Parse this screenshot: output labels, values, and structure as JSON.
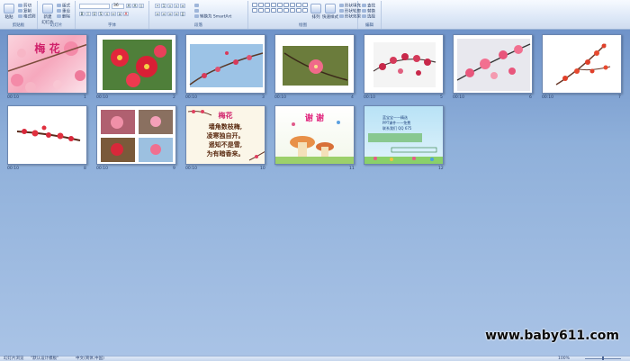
{
  "ribbon": {
    "groups": [
      {
        "label": "剪贴板"
      },
      {
        "label": "幻灯片"
      },
      {
        "label": "字体"
      },
      {
        "label": "段落"
      },
      {
        "label": "绘图"
      },
      {
        "label": "编辑"
      }
    ],
    "clipboard": {
      "paste": "粘贴",
      "cut": "剪切",
      "copy": "复制",
      "painter": "格式刷"
    },
    "slides": {
      "new_slide": "新建\n幻灯片",
      "layout": "版式",
      "reset": "重设",
      "delete": "删除"
    },
    "font": {
      "font_value": "",
      "size_value": "36"
    },
    "paragraph": {
      "smartart": "转换为 SmartArt"
    },
    "drawing": {
      "arrange": "排列",
      "quick_styles": "快速样式",
      "fill": "形状填充",
      "outline": "形状轮廓",
      "effects": "形状效果"
    },
    "editing": {
      "find": "查找",
      "replace": "替换",
      "select": "选择"
    }
  },
  "slides": [
    {
      "number": "1",
      "meta": "00:10",
      "title": "梅 花"
    },
    {
      "number": "2",
      "meta": "00:10"
    },
    {
      "number": "3",
      "meta": "00:10"
    },
    {
      "number": "4",
      "meta": "00:10"
    },
    {
      "number": "5",
      "meta": "00:10"
    },
    {
      "number": "6",
      "meta": "00:10"
    },
    {
      "number": "7",
      "meta": "00:10"
    },
    {
      "number": "8",
      "meta": "00:10"
    },
    {
      "number": "9",
      "meta": "00:10"
    },
    {
      "number": "10",
      "meta": "00:10",
      "title": "梅花",
      "poem": [
        "墙角数枝梅,",
        "凌寒独自开。",
        "遥知不是雪,",
        "为有暗香来。"
      ]
    },
    {
      "number": "11",
      "meta": "",
      "title": "谢 谢"
    },
    {
      "number": "12",
      "meta": "",
      "lines": [
        "蓝宝宝——精选",
        "PPT课件——免费",
        "联系我们 QQ 675"
      ]
    }
  ],
  "watermark": "www.baby611.com",
  "status": {
    "view": "幻灯片浏览",
    "theme": "\"默认设计模板\"",
    "language": "中文(简体,中国)",
    "zoom": "100%"
  }
}
